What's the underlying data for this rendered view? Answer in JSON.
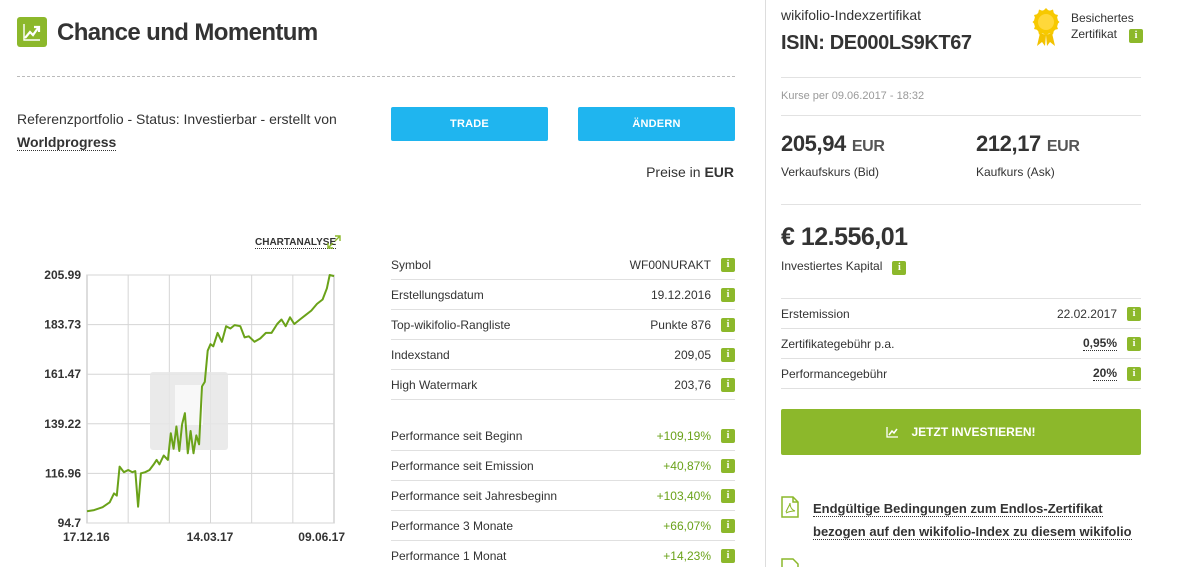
{
  "header": {
    "title": "Chance und Momentum",
    "title_icon": "trending-up-icon"
  },
  "status": {
    "text": "Referenzportfolio - Status: Investierbar - erstellt von",
    "author": "Worldprogress"
  },
  "buttons": {
    "trade": "TRADE",
    "change": "ÄNDERN"
  },
  "prices_in": {
    "label": "Preise in",
    "currency": "EUR"
  },
  "chart": {
    "link_label": "CHARTANALYSE",
    "link_icon": "expand-icon",
    "watermark_icon": "wikifolio-logo-watermark"
  },
  "chart_data": {
    "type": "line",
    "title": "",
    "xlabel": "",
    "ylabel": "",
    "x_ticks": [
      "17.12.16",
      "14.03.17",
      "09.06.17"
    ],
    "y_ticks": [
      205.99,
      183.73,
      161.47,
      139.22,
      116.96,
      94.7
    ],
    "ylim": [
      94.7,
      205.99
    ],
    "xlim": [
      "2016-12-17",
      "2017-06-09"
    ],
    "grid": true,
    "series": [
      {
        "color": "#6aa219",
        "points": [
          [
            "2016-12-17",
            100.0
          ],
          [
            "2016-12-22",
            100.5
          ],
          [
            "2016-12-28",
            101.8
          ],
          [
            "2017-01-02",
            104.0
          ],
          [
            "2017-01-05",
            108.0
          ],
          [
            "2017-01-07",
            107.0
          ],
          [
            "2017-01-09",
            120.0
          ],
          [
            "2017-01-12",
            117.5
          ],
          [
            "2017-01-15",
            118.5
          ],
          [
            "2017-01-18",
            117.5
          ],
          [
            "2017-01-20",
            118.0
          ],
          [
            "2017-01-22",
            102.0
          ],
          [
            "2017-01-24",
            117.0
          ],
          [
            "2017-01-27",
            117.5
          ],
          [
            "2017-01-30",
            118.5
          ],
          [
            "2017-02-02",
            121.0
          ],
          [
            "2017-02-04",
            123.0
          ],
          [
            "2017-02-06",
            121.0
          ],
          [
            "2017-02-09",
            125.0
          ],
          [
            "2017-02-12",
            123.0
          ],
          [
            "2017-02-14",
            135.0
          ],
          [
            "2017-02-16",
            128.0
          ],
          [
            "2017-02-18",
            138.0
          ],
          [
            "2017-02-20",
            127.0
          ],
          [
            "2017-02-22",
            139.0
          ],
          [
            "2017-02-24",
            144.0
          ],
          [
            "2017-02-26",
            126.0
          ],
          [
            "2017-02-28",
            136.0
          ],
          [
            "2017-03-02",
            126.0
          ],
          [
            "2017-03-04",
            134.0
          ],
          [
            "2017-03-06",
            130.0
          ],
          [
            "2017-03-08",
            156.0
          ],
          [
            "2017-03-10",
            158.0
          ],
          [
            "2017-03-12",
            172.0
          ],
          [
            "2017-03-14",
            175.0
          ],
          [
            "2017-03-16",
            174.0
          ],
          [
            "2017-03-19",
            180.0
          ],
          [
            "2017-03-22",
            176.0
          ],
          [
            "2017-03-25",
            183.0
          ],
          [
            "2017-03-28",
            182.0
          ],
          [
            "2017-03-31",
            183.5
          ],
          [
            "2017-04-04",
            183.0
          ],
          [
            "2017-04-07",
            178.0
          ],
          [
            "2017-04-10",
            178.5
          ],
          [
            "2017-04-14",
            176.0
          ],
          [
            "2017-04-18",
            177.5
          ],
          [
            "2017-04-22",
            180.0
          ],
          [
            "2017-04-26",
            180.0
          ],
          [
            "2017-04-30",
            184.0
          ],
          [
            "2017-05-03",
            186.0
          ],
          [
            "2017-05-06",
            183.0
          ],
          [
            "2017-05-09",
            187.0
          ],
          [
            "2017-05-12",
            184.0
          ],
          [
            "2017-05-16",
            186.0
          ],
          [
            "2017-05-20",
            188.0
          ],
          [
            "2017-05-24",
            190.0
          ],
          [
            "2017-05-28",
            193.0
          ],
          [
            "2017-06-01",
            195.0
          ],
          [
            "2017-06-04",
            200.0
          ],
          [
            "2017-06-06",
            205.99
          ],
          [
            "2017-06-09",
            205.5
          ]
        ]
      }
    ]
  },
  "info_table": {
    "rows": [
      {
        "label": "Symbol",
        "value": "WF00NURAKT",
        "green": false
      },
      {
        "label": "Erstellungsdatum",
        "value": "19.12.2016",
        "green": false
      },
      {
        "label": "Top-wikifolio-Rangliste",
        "value": "Punkte 876",
        "green": false
      },
      {
        "label": "Indexstand",
        "value": "209,05",
        "green": false
      },
      {
        "label": "High Watermark",
        "value": "203,76",
        "green": false
      }
    ],
    "performance": [
      {
        "label": "Performance seit Beginn",
        "value": "+109,19%",
        "green": true
      },
      {
        "label": "Performance seit Emission",
        "value": "+40,87%",
        "green": true
      },
      {
        "label": "Performance seit Jahresbeginn",
        "value": "+103,40%",
        "green": true
      },
      {
        "label": "Performance 3 Monate",
        "value": "+66,07%",
        "green": true
      },
      {
        "label": "Performance 1 Monat",
        "value": "+14,23%",
        "green": true
      }
    ],
    "info_badge": "i"
  },
  "right_panel": {
    "subtitle": "wikifolio-Indexzertifikat",
    "isin": "ISIN: DE000LS9KT67",
    "badge_line1": "Besichertes",
    "badge_line2": "Zertifikat",
    "badge_icon": "gold-seal-icon",
    "kurse": "Kurse per 09.06.2017 - 18:32",
    "bid_value": "205,94",
    "bid_currency": "EUR",
    "bid_label": "Verkaufskurs (Bid)",
    "ask_value": "212,17",
    "ask_currency": "EUR",
    "ask_label": "Kaufkurs (Ask)",
    "capital": "€ 12.556,01",
    "capital_label": "Investiertes Kapital",
    "fees": [
      {
        "label": "Erstemission",
        "value": "22.02.2017",
        "underline": false
      },
      {
        "label": "Zertifikategebühr p.a.",
        "value": "0,95%",
        "underline": true
      },
      {
        "label": "Performancegebühr",
        "value": "20%",
        "underline": true
      }
    ],
    "invest_button": "JETZT INVESTIEREN!",
    "invest_icon": "trending-up-icon",
    "doc_link": "Endgültige Bedingungen zum Endlos-Zertifikat bezogen auf den wikifolio-Index zu diesem wikifolio",
    "doc_icon": "pdf-icon"
  },
  "colors": {
    "accent_green": "#8cb82b",
    "button_blue": "#1fb5ef",
    "positive_green": "#6aa219"
  }
}
